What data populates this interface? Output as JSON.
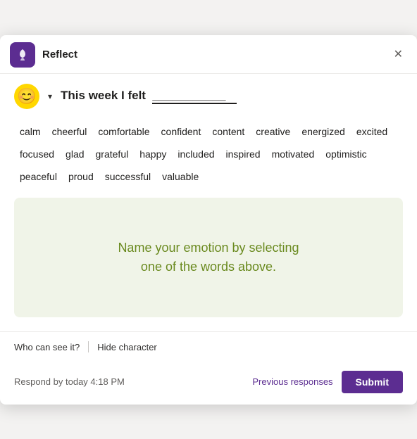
{
  "dialog": {
    "title": "Reflect"
  },
  "header": {
    "app_icon_alt": "reflect-app-icon",
    "emoji": "😊",
    "prompt_start": "This week I felt",
    "prompt_underline": "___________",
    "chevron_label": "▾"
  },
  "emotion_words": [
    "calm",
    "cheerful",
    "comfortable",
    "confident",
    "content",
    "creative",
    "energized",
    "excited",
    "focused",
    "glad",
    "grateful",
    "happy",
    "included",
    "inspired",
    "motivated",
    "optimistic",
    "peaceful",
    "proud",
    "successful",
    "valuable"
  ],
  "emotion_box": {
    "line1": "Name your emotion by selecting",
    "line2": "one of the words above."
  },
  "footer": {
    "who_can_see": "Who can see it?",
    "hide_character": "Hide character"
  },
  "bottom_bar": {
    "respond_by": "Respond by today 4:18 PM",
    "previous_responses": "Previous responses",
    "submit": "Submit"
  }
}
